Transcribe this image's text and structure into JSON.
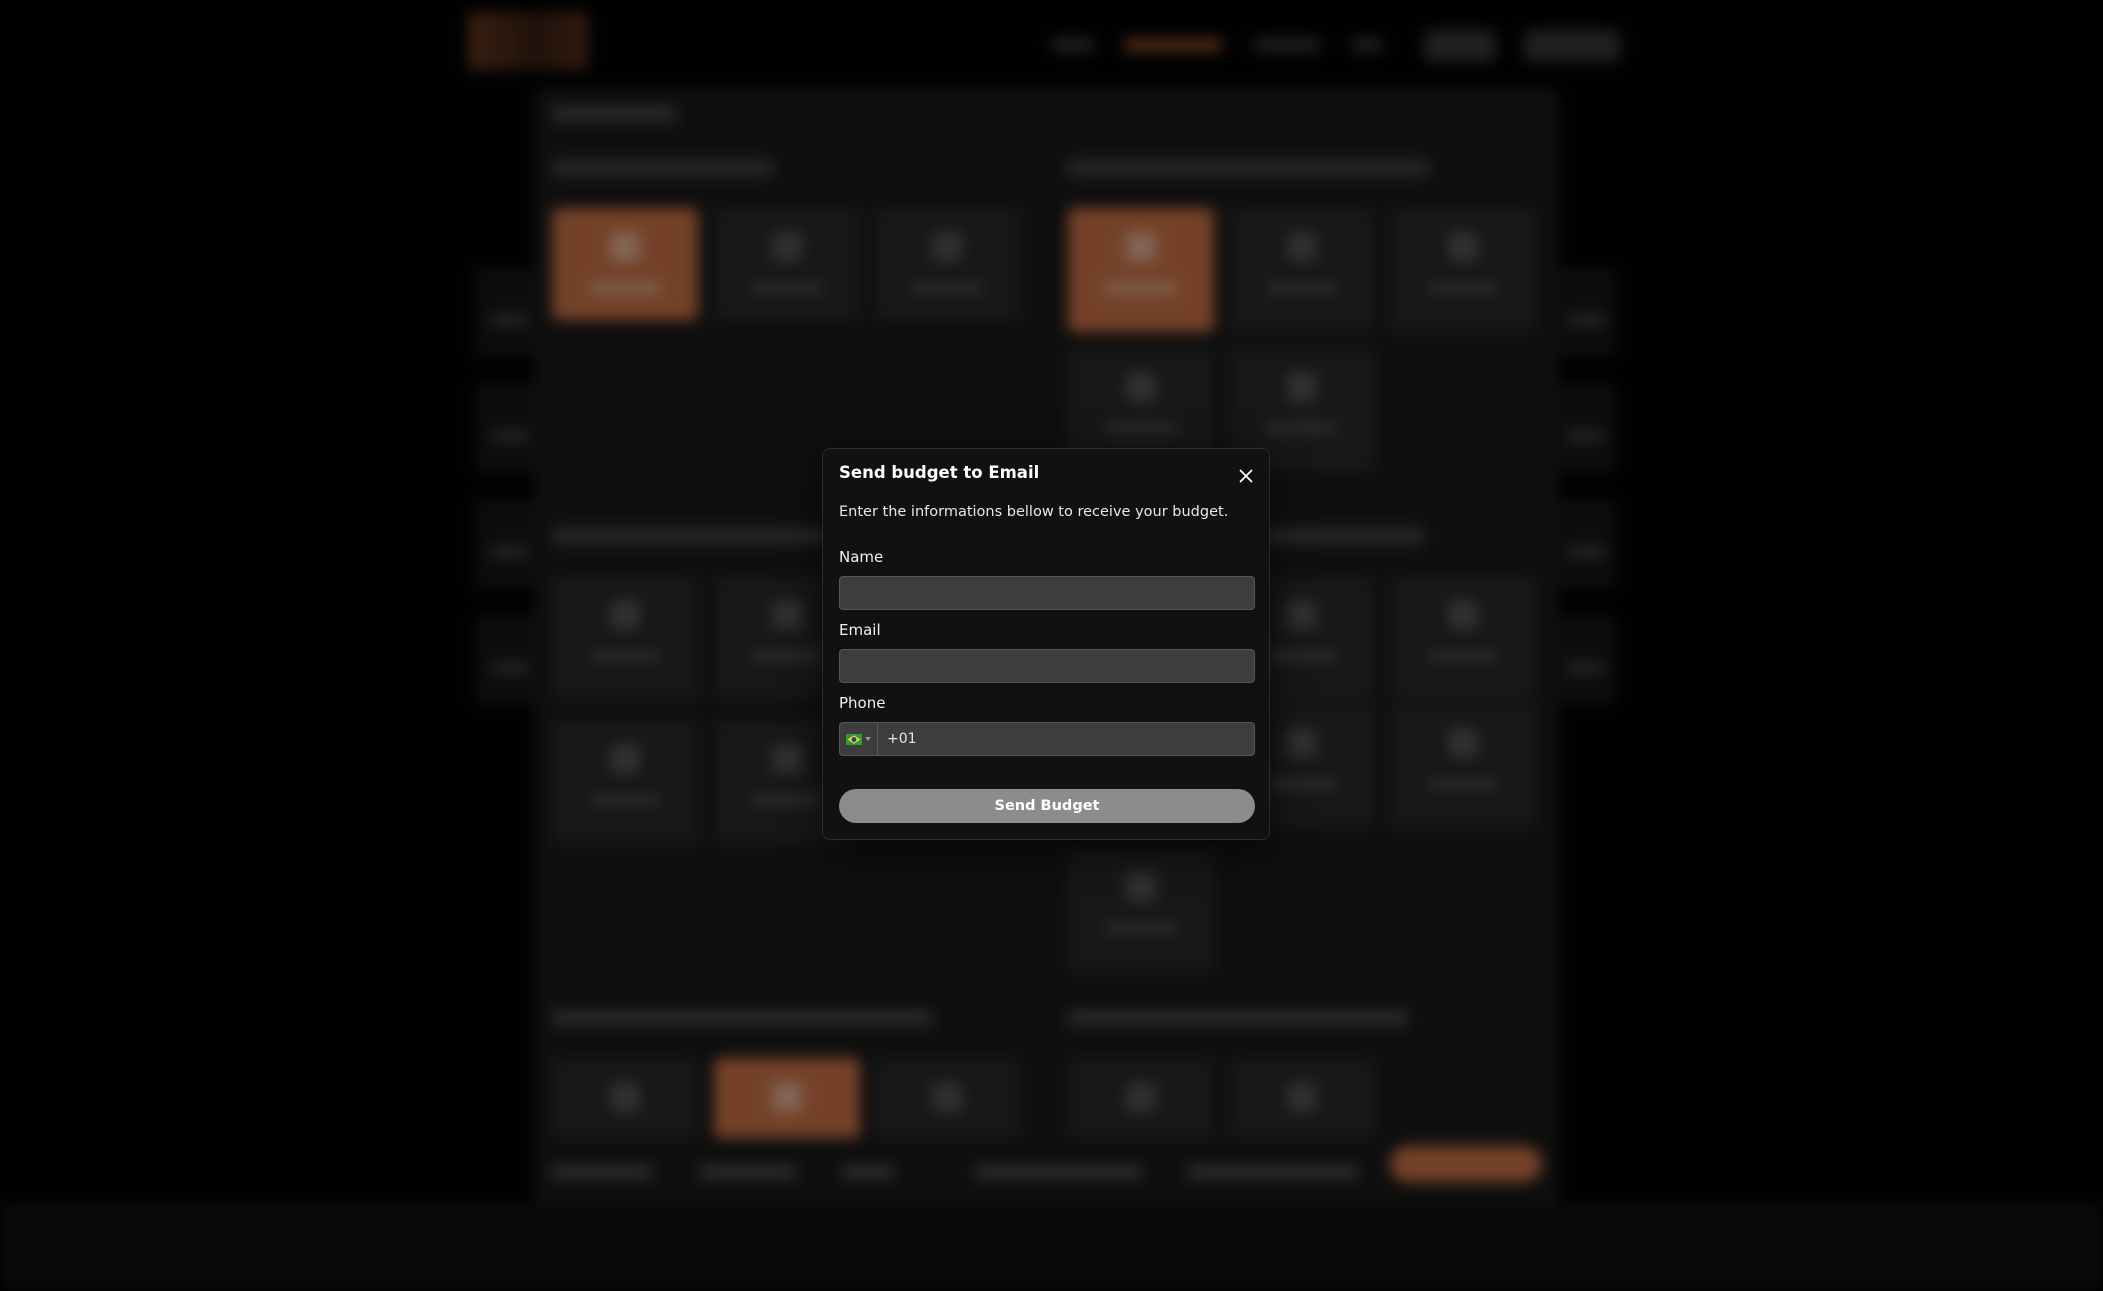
{
  "modal": {
    "title": "Send budget to Email",
    "description": "Enter the informations bellow to receive your budget.",
    "fields": {
      "name": {
        "label": "Name",
        "value": "",
        "placeholder": ""
      },
      "email": {
        "label": "Email",
        "value": "",
        "placeholder": ""
      },
      "phone": {
        "label": "Phone",
        "value": "+01",
        "country": "brazil-flag-icon"
      }
    },
    "submit_label": "Send Budget",
    "close_icon": "close-icon"
  },
  "colors": {
    "accent": "#d3774a",
    "modal_bg": "#111111",
    "input_bg": "#3d3d3d",
    "button_disabled": "#8c8c8c"
  }
}
